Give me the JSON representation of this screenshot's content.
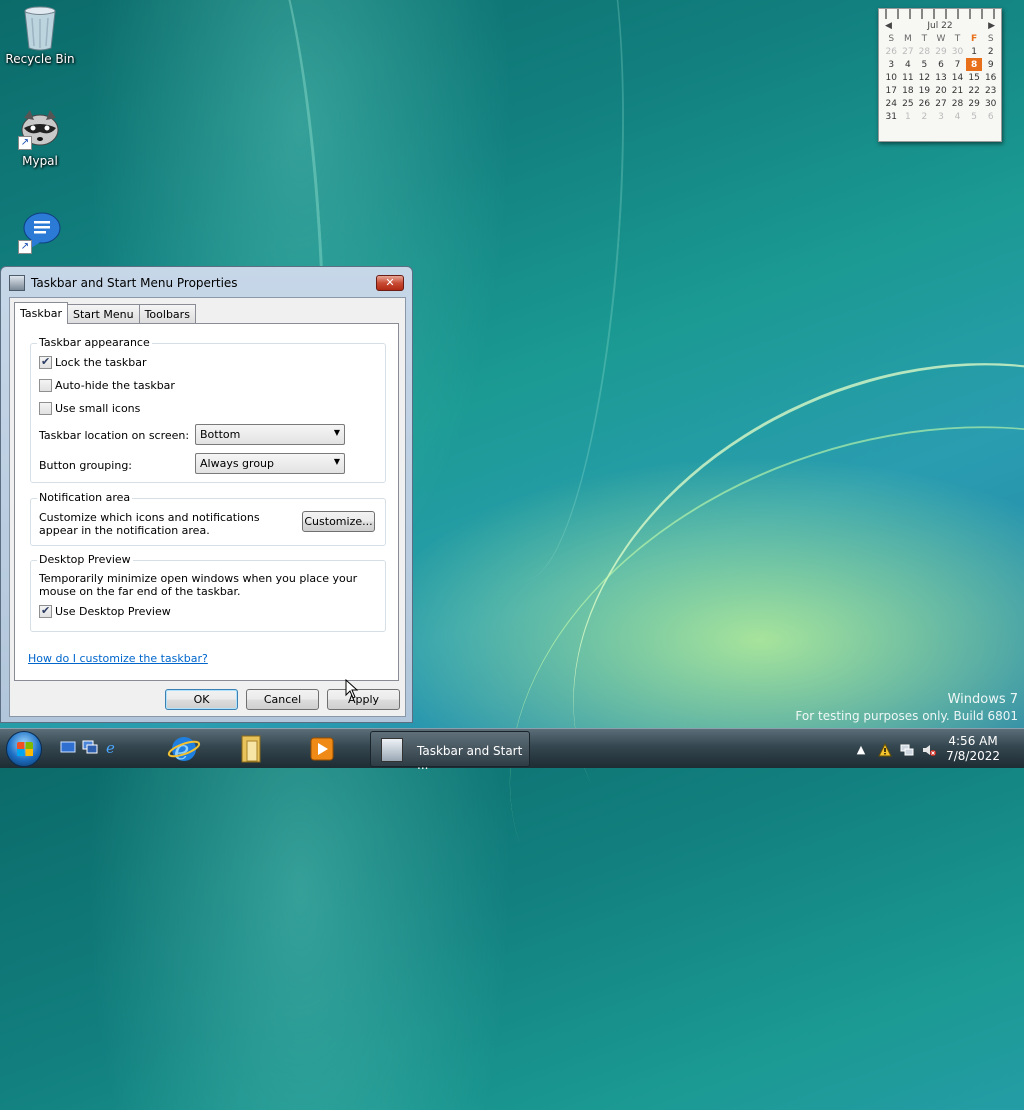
{
  "desktop": {
    "icons": [
      {
        "label": "Recycle Bin"
      },
      {
        "label": "Mypal"
      },
      {
        "label": ""
      }
    ],
    "watermark": {
      "line1": "Windows 7",
      "line2": "For testing purposes only. Build 6801"
    }
  },
  "calendar": {
    "month": "Jul 22",
    "weekdays": [
      "S",
      "M",
      "T",
      "W",
      "T",
      "F",
      "S"
    ],
    "rows": [
      [
        "26",
        "27",
        "28",
        "29",
        "30",
        "1",
        "2"
      ],
      [
        "3",
        "4",
        "5",
        "6",
        "7",
        "8",
        "9"
      ],
      [
        "10",
        "11",
        "12",
        "13",
        "14",
        "15",
        "16"
      ],
      [
        "17",
        "18",
        "19",
        "20",
        "21",
        "22",
        "23"
      ],
      [
        "24",
        "25",
        "26",
        "27",
        "28",
        "29",
        "30"
      ],
      [
        "31",
        "1",
        "2",
        "3",
        "4",
        "5",
        "6"
      ]
    ],
    "today": "8",
    "accent": "#e8701a"
  },
  "dialog": {
    "title": "Taskbar and Start Menu Properties",
    "close_label": "✕",
    "tabs": [
      "Taskbar",
      "Start Menu",
      "Toolbars"
    ],
    "appearance": {
      "legend": "Taskbar appearance",
      "lock": {
        "label": "Lock the taskbar",
        "checked": true
      },
      "autohide": {
        "label": "Auto-hide the taskbar",
        "checked": false
      },
      "small_icons": {
        "label": "Use small icons",
        "checked": false
      },
      "location_label": "Taskbar location on screen:",
      "location_value": "Bottom",
      "grouping_label": "Button grouping:",
      "grouping_value": "Always group"
    },
    "notification": {
      "legend": "Notification area",
      "text": "Customize which icons and notifications appear in the notification area.",
      "button": "Customize..."
    },
    "preview": {
      "legend": "Desktop Preview",
      "text": "Temporarily minimize open windows when you place your mouse on the far end of the taskbar.",
      "checkbox": {
        "label": "Use Desktop Preview",
        "checked": true
      }
    },
    "help_link": "How do I customize the taskbar?",
    "buttons": {
      "ok": "OK",
      "cancel": "Cancel",
      "apply": "Apply"
    }
  },
  "taskbar": {
    "active_window": "Taskbar and Start ...",
    "clock_time": "4:56 AM",
    "clock_date": "7/8/2022",
    "tray_arrow": "▲"
  },
  "colors": {
    "link": "#0066cc",
    "close_button": "#c94b34",
    "default_button_border": "#3c7fb1"
  }
}
